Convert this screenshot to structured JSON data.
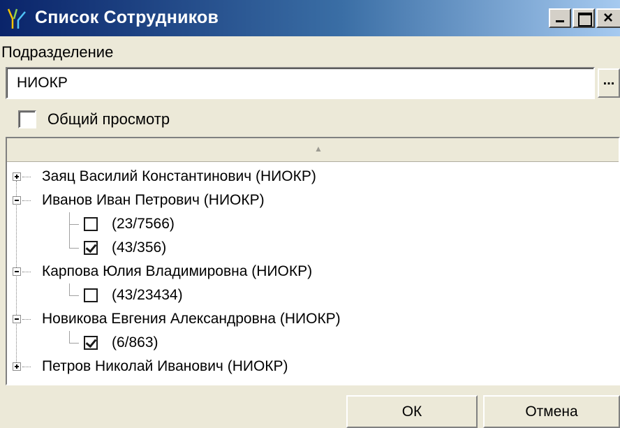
{
  "window": {
    "title": "Список Сотрудников",
    "icon": "people-app-icon"
  },
  "department": {
    "label": "Подразделение",
    "value": "НИОКР",
    "browse_label": "..."
  },
  "general_view": {
    "label": "Общий просмотр",
    "checked": false
  },
  "employees": [
    {
      "name": "Заяц Василий Константинович (НИОКР)",
      "expanded": false,
      "cards": []
    },
    {
      "name": "Иванов Иван Петрович (НИОКР)",
      "expanded": true,
      "cards": [
        {
          "label": "(23/7566)",
          "checked": false
        },
        {
          "label": "(43/356)",
          "checked": true
        }
      ]
    },
    {
      "name": "Карпова Юлия Владимировна (НИОКР)",
      "expanded": true,
      "cards": [
        {
          "label": "(43/23434)",
          "checked": false
        }
      ]
    },
    {
      "name": "Новикова Евгения Александровна (НИОКР)",
      "expanded": true,
      "cards": [
        {
          "label": "(6/863)",
          "checked": true
        }
      ]
    },
    {
      "name": "Петров Николай Иванович (НИОКР)",
      "expanded": false,
      "cards": []
    }
  ],
  "buttons": {
    "ok": "ОК",
    "cancel": "Отмена"
  }
}
